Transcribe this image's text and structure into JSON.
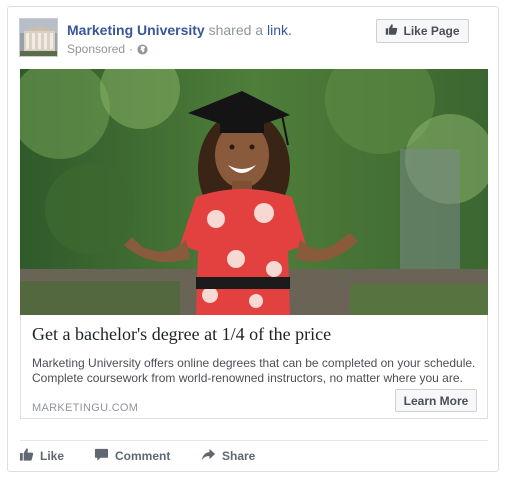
{
  "post": {
    "page_name": "Marketing University",
    "shared_text": "shared a",
    "link_word": "link.",
    "sponsored_label": "Sponsored",
    "separator": "·",
    "like_page_label": "Like Page"
  },
  "link_card": {
    "headline": "Get a bachelor's degree at 1/4 of the price",
    "description": "Marketing University offers online degrees that can be completed on your schedule. Complete coursework from world-renowned instructors, no matter where you are.",
    "domain": "MARKETINGU.COM",
    "cta_label": "Learn More"
  },
  "actions": {
    "like": "Like",
    "comment": "Comment",
    "share": "Share"
  },
  "icons": {
    "like": "thumbs-up-icon",
    "comment": "comment-icon",
    "share": "share-icon",
    "audience": "globe-icon"
  },
  "colors": {
    "link_blue": "#365899",
    "secondary_text": "#90949c",
    "action_text": "#616770",
    "border": "#dddfe2"
  }
}
